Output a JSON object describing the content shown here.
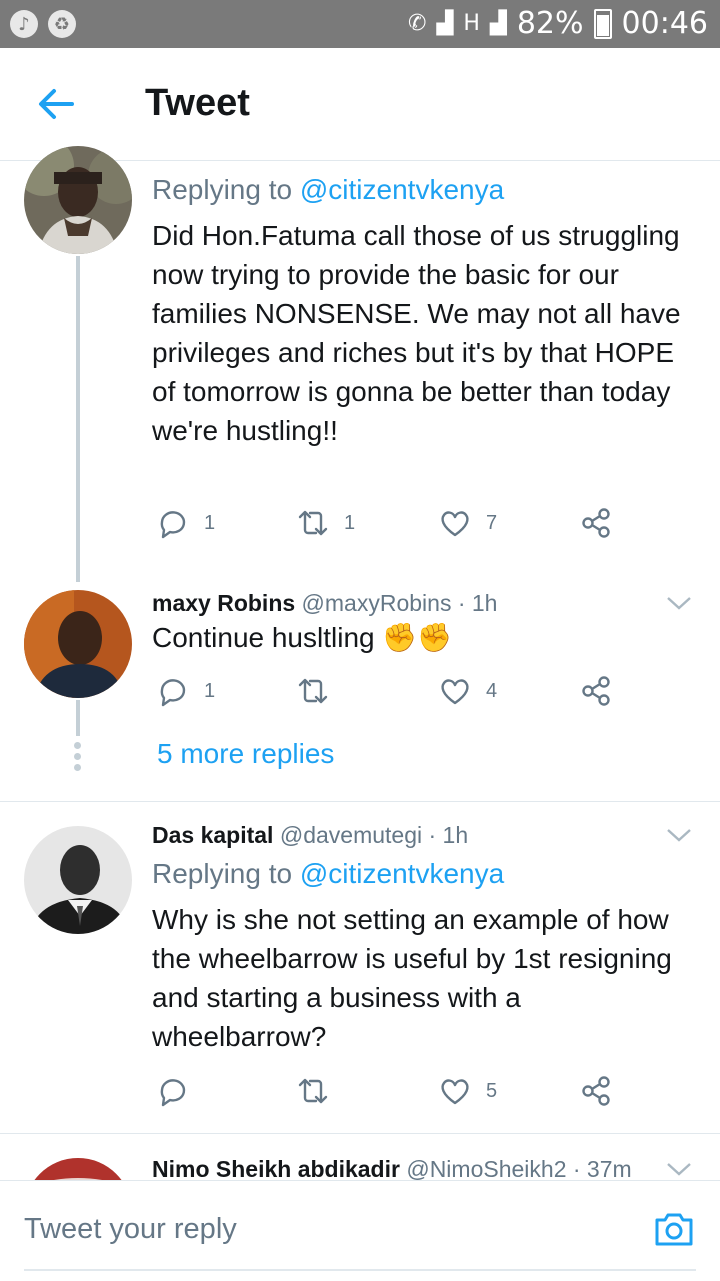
{
  "status_bar": {
    "battery": "82%",
    "time": "00:46",
    "network_type": "H"
  },
  "header": {
    "title": "Tweet"
  },
  "tweets": [
    {
      "replying_prefix": "Replying to",
      "replying_to": "@citizentvkenya",
      "text": "Did Hon.Fatuma call those of us struggling now trying to provide the basic for our families NONSENSE. We may not all have privileges and riches but it's by that HOPE of tomorrow is gonna be better than today we're hustling!!",
      "replies": "1",
      "retweets": "1",
      "likes": "7"
    },
    {
      "name": "maxy Robins",
      "handle": "@maxyRobins",
      "time": "· 1h",
      "text": "Continue husltling ✊✊",
      "replies": "1",
      "retweets": "",
      "likes": "4"
    },
    {
      "name": "Das kapital",
      "handle": "@davemutegi",
      "time": "· 1h",
      "replying_prefix": "Replying to",
      "replying_to": "@citizentvkenya",
      "text": "Why is she not setting an example of how the wheelbarrow is useful by 1st resigning and starting a business with a wheelbarrow?",
      "replies": "",
      "retweets": "",
      "likes": "5"
    },
    {
      "name": "Nimo Sheikh abdikadir",
      "handle": "@NimoSheikh2",
      "time": "· 37m"
    }
  ],
  "more_replies": "5 more replies",
  "reply_bar": {
    "placeholder": "Tweet your reply"
  },
  "colors": {
    "accent": "#1da1f2",
    "secondary_text": "#657786",
    "status_bar": "#7a7a7a"
  }
}
